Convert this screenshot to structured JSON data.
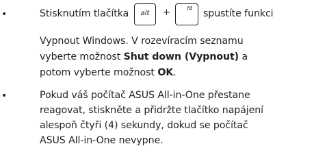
{
  "bullets": [
    {
      "symbol": "•",
      "line1_before": "Stisknutím tlačítka",
      "line1_after": "spustíte funkci",
      "keys": {
        "alt": "alt",
        "plus": "+",
        "f4": "f4"
      },
      "line2": "Vypnout Windows. V rozevíracím seznamu",
      "line3_before": "vyberte možnost ",
      "line3_bold": "Shut down (Vypnout)",
      "line3_after": " a",
      "line4_before": "potom vyberte možnost ",
      "line4_bold": "OK",
      "line4_after": "."
    },
    {
      "symbol": "•",
      "lines": [
        "Pokud váš počítač ASUS All-in-One přestane",
        "reagovat, stiskněte a přidržte tlačítko napájení",
        "alespoň čtyři (4) sekundy, dokud se počítač",
        "ASUS All-in-One nevypne."
      ]
    }
  ]
}
